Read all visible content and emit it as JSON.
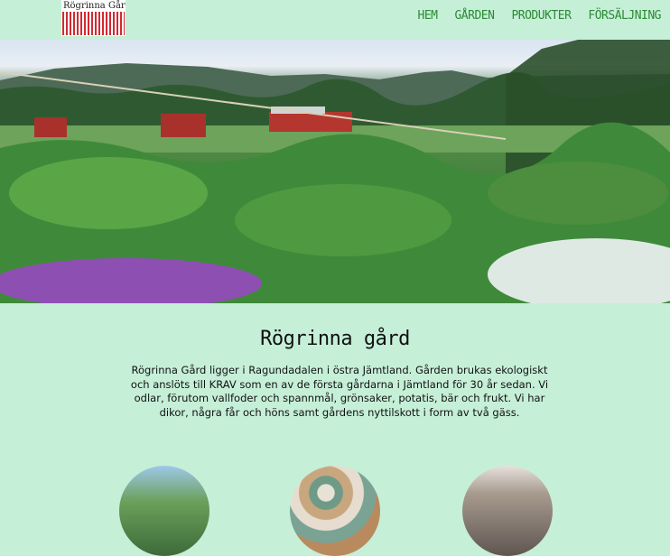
{
  "header": {
    "logo_text": "Rögrinna Gård",
    "nav": [
      "Hem",
      "Gården",
      "Produkter",
      "Försäljning"
    ]
  },
  "hero": {
    "description": ""
  },
  "main": {
    "title": "Rögrinna gård",
    "paragraph": "Rögrinna Gård ligger i Ragundadalen i östra Jämtland. Gården brukas ekologiskt och anslöts till KRAV som en av de första gårdarna i Jämtland för 30 år sedan. Vi odlar, förutom vallfoder och spannmål, grönsaker, potatis, bär och frukt. Vi har dikor, några får och höns samt gårdens nyttilskott i form av två gäss."
  },
  "colors": {
    "background": "#c6efd8",
    "nav_text": "#2c8a34",
    "logo_red": "#d22a32"
  }
}
